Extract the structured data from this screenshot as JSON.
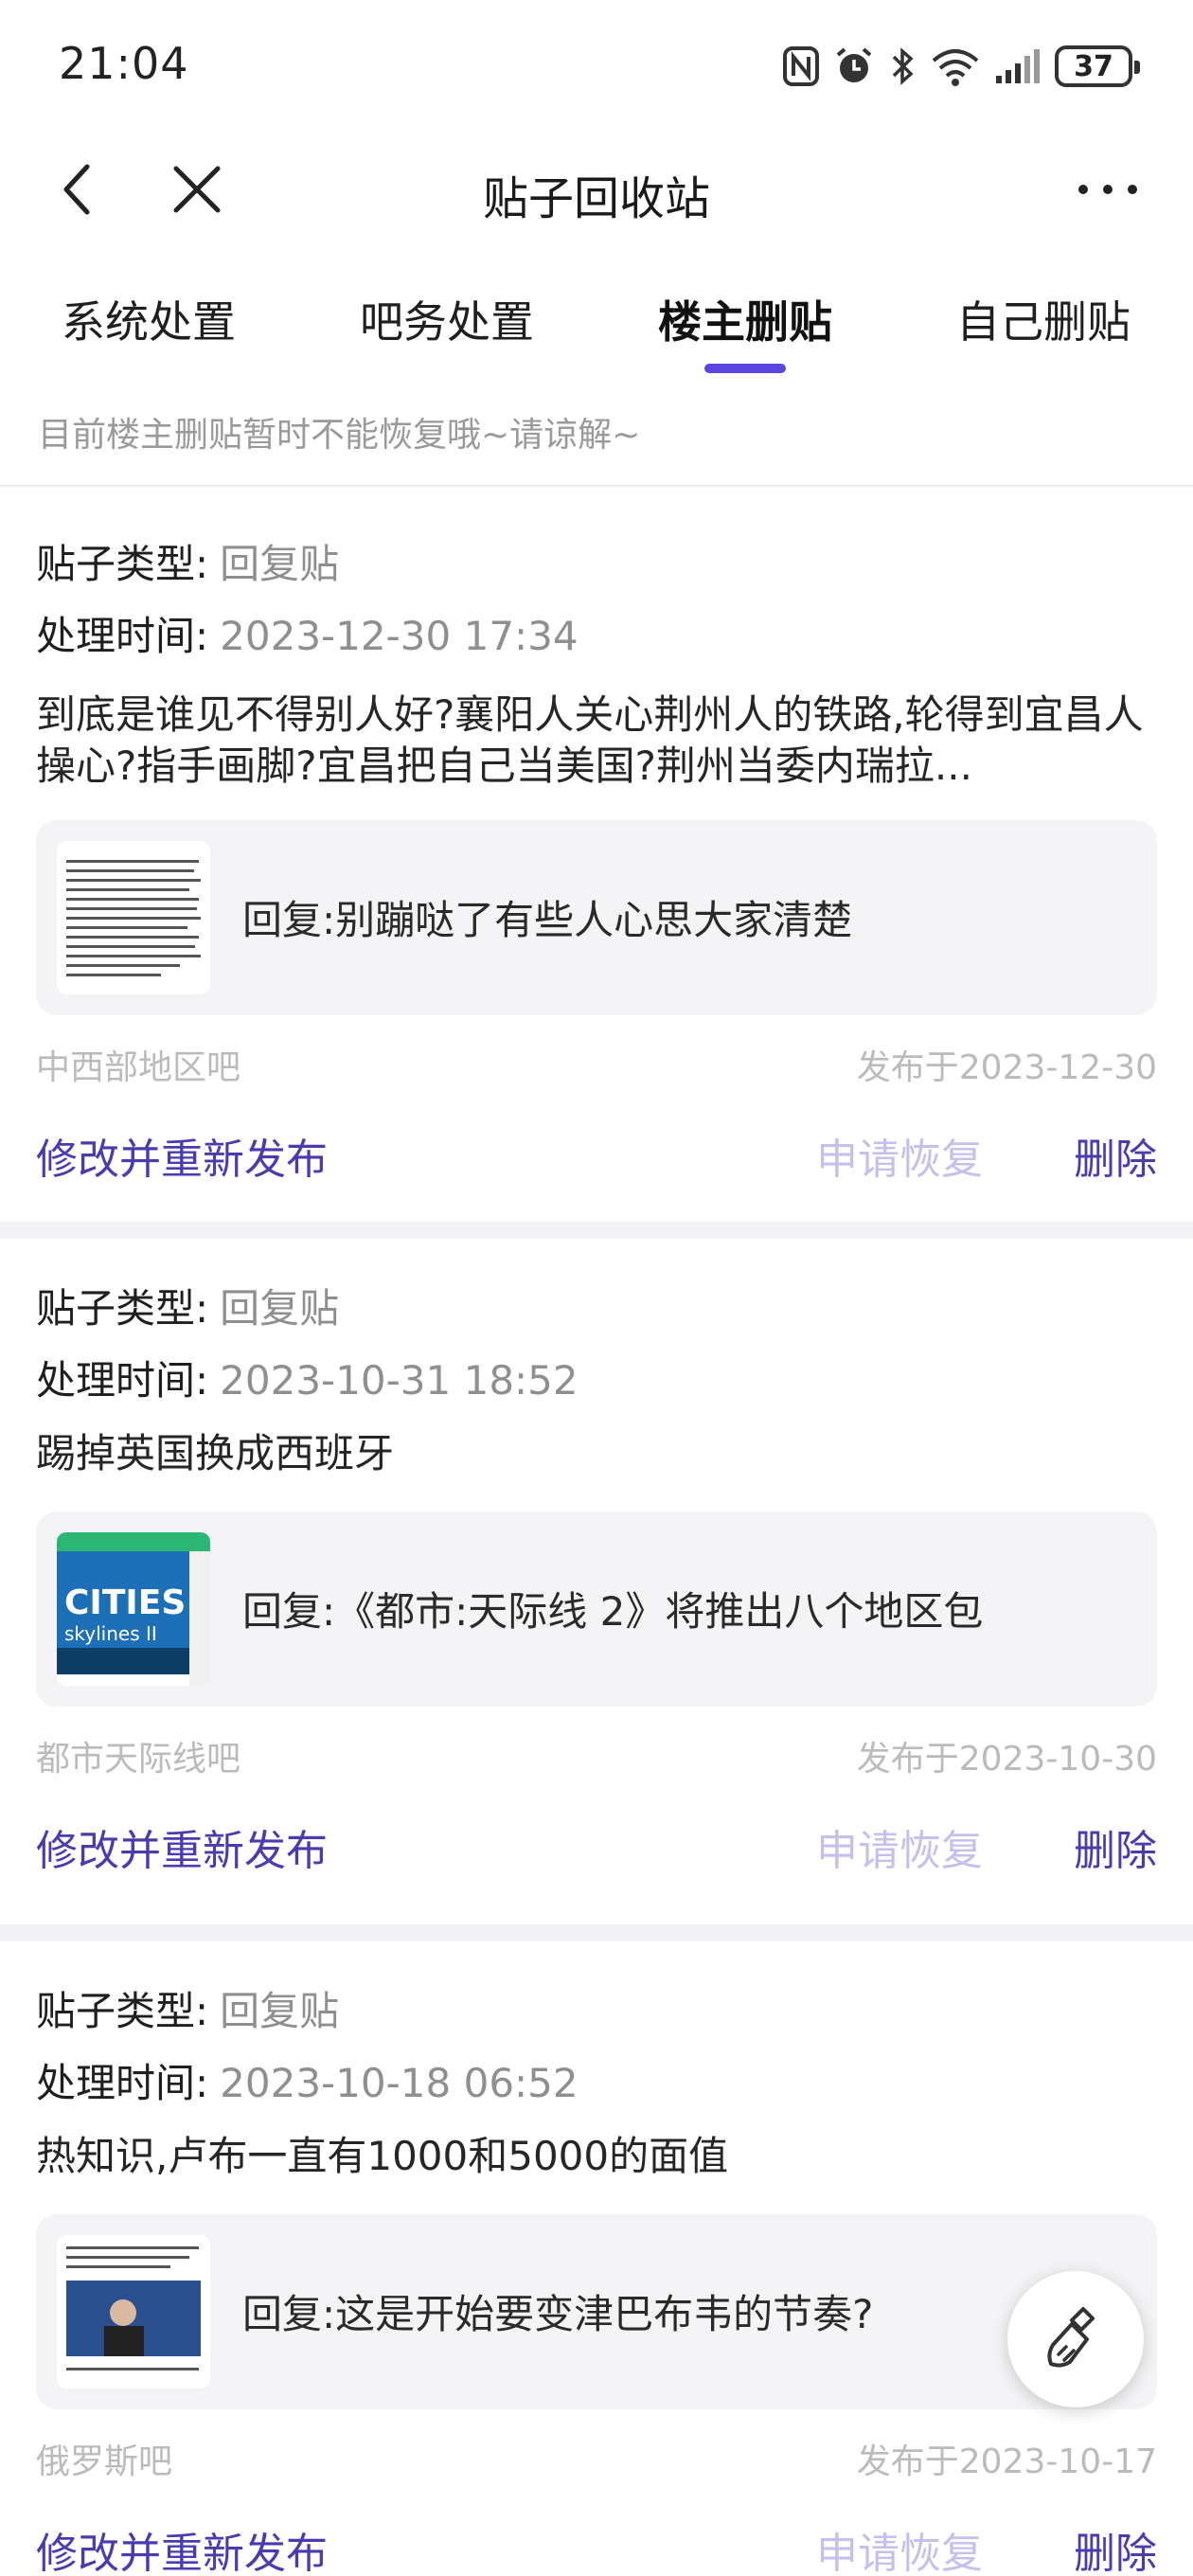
{
  "status": {
    "time": "21:04",
    "battery": "37",
    "icons": [
      "nfc-icon",
      "alarm-icon",
      "bluetooth-icon",
      "wifi-icon",
      "signal-icon",
      "battery-icon"
    ]
  },
  "nav": {
    "title": "贴子回收站",
    "back_icon": "back-arrow-icon",
    "close_icon": "close-icon",
    "more_icon": "more-dots-icon"
  },
  "tabs": [
    {
      "label": "系统处置",
      "active": false
    },
    {
      "label": "吧务处置",
      "active": false
    },
    {
      "label": "楼主删贴",
      "active": true
    },
    {
      "label": "自己删贴",
      "active": false
    }
  ],
  "accent_color": "#5b46e0",
  "notice": "目前楼主删贴暂时不能恢复哦~请谅解~",
  "labels": {
    "type": "贴子类型:",
    "time": "处理时间:",
    "edit": "修改并重新发布",
    "restore": "申请恢复",
    "delete": "删除"
  },
  "posts": [
    {
      "type": "回复贴",
      "time": "2023-12-30 17:34",
      "content": "到底是谁见不得别人好?襄阳人关心荆州人的铁路,轮得到宜昌人操心?指手画脚?宜昌把自己当美国?荆州当委内瑞拉...",
      "reply": "回复:别蹦哒了有些人心思大家清楚",
      "forum": "中西部地区吧",
      "date": "发布于2023-12-30"
    },
    {
      "type": "回复贴",
      "time": "2023-10-31 18:52",
      "content": "踢掉英国换成西班牙",
      "reply": "回复:《都市:天际线 2》将推出八个地区包",
      "thumb_title": "CITIES",
      "thumb_sub": "skylines II",
      "forum": "都市天际线吧",
      "date": "发布于2023-10-30"
    },
    {
      "type": "回复贴",
      "time": "2023-10-18 06:52",
      "content": "热知识,卢布一直有1000和5000的面值",
      "reply": "回复:这是开始要变津巴布韦的节奏?",
      "forum": "俄罗斯吧",
      "date": "发布于2023-10-17"
    }
  ],
  "fab_icon": "broom-icon"
}
